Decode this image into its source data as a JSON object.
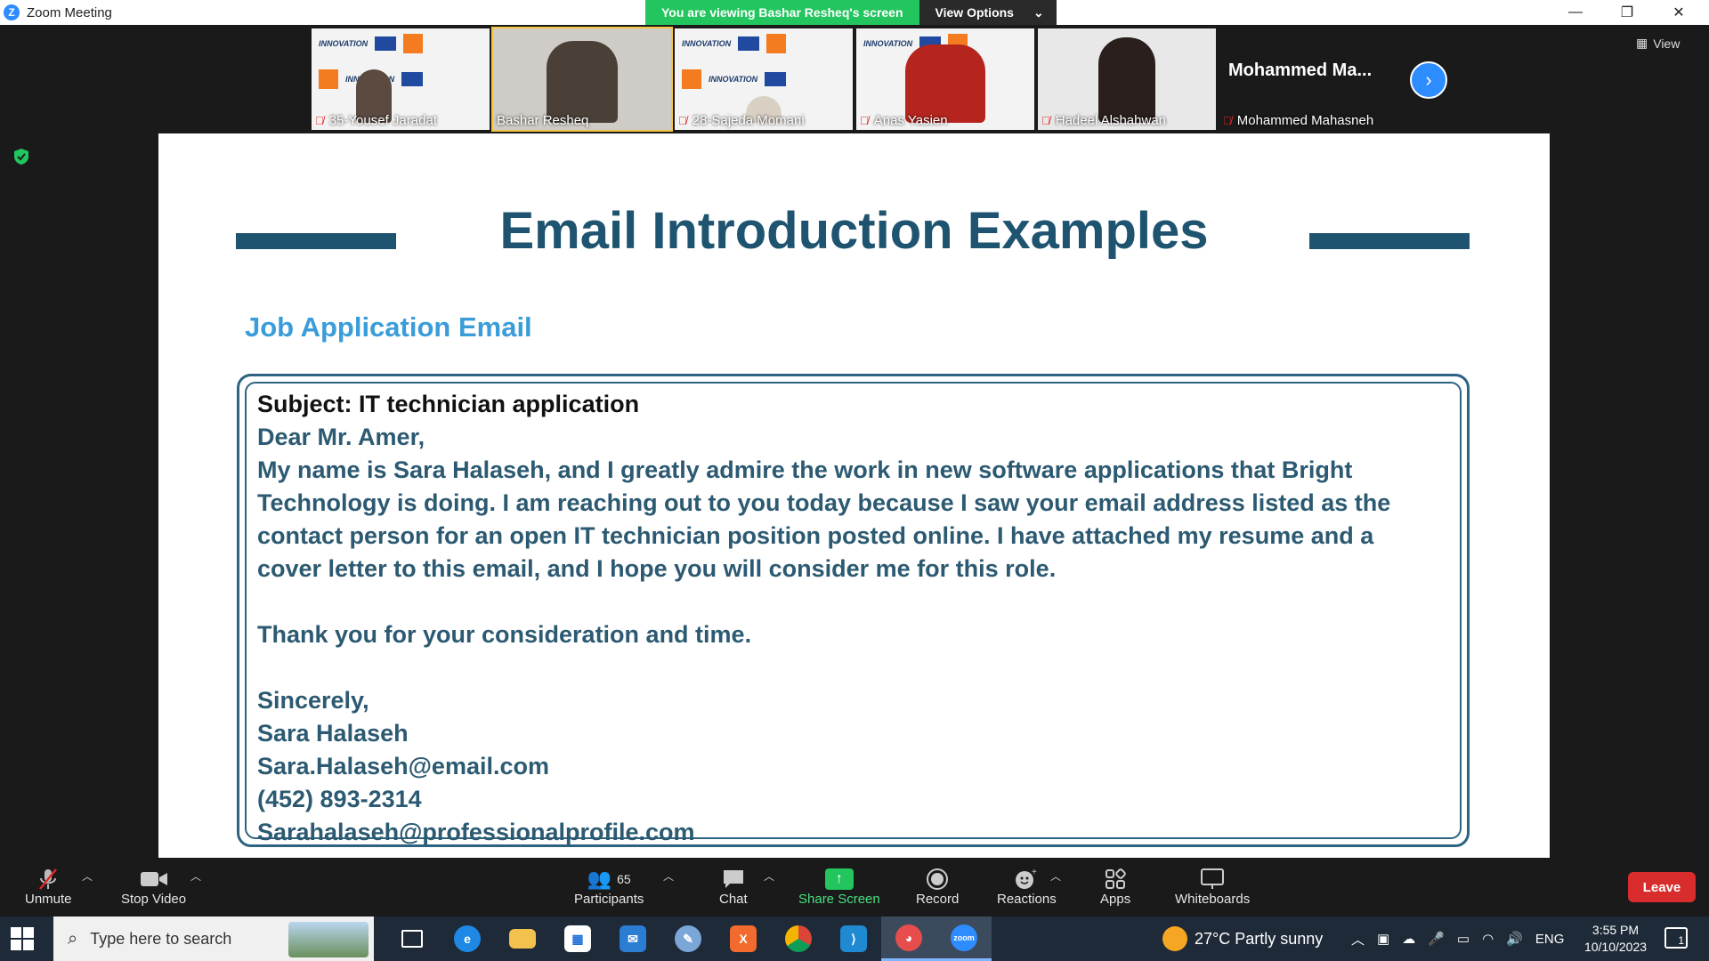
{
  "window": {
    "title": "Zoom Meeting",
    "viewing_banner": "You are viewing Bashar Resheq's screen",
    "view_options": "View Options",
    "view_button": "View"
  },
  "participants_strip": [
    {
      "name": "35-Yousef Jaradat",
      "muted": true
    },
    {
      "name": "Bashar Resheq",
      "muted": false
    },
    {
      "name": "28-Sajeda Momani",
      "muted": true
    },
    {
      "name": "Anas Yasien",
      "muted": true
    },
    {
      "name": "Hadeel Alshahwan",
      "muted": true
    },
    {
      "name": "Mohammed Mahasneh",
      "display_name": "Mohammed  Ma...",
      "muted": true
    }
  ],
  "slide": {
    "title": "Email Introduction Examples",
    "subtitle": "Job Application Email",
    "email": {
      "subject": "Subject: IT technician application",
      "greeting": "Dear Mr. Amer,",
      "body": "My name is Sara Halaseh, and I greatly admire the work in new software applications that Bright Technology is doing. I am reaching out to you today because I saw your email address listed as the contact person for an open IT technician position posted online. I have attached my resume and a cover letter to this email, and I hope you will consider me for this role.",
      "thanks": "Thank you for your consideration and time.",
      "closing": "Sincerely,",
      "signature_name": "Sara Halaseh",
      "signature_email": "Sara.Halaseh@email.com",
      "signature_phone": "(452) 893-2314",
      "signature_profile": "Sarahalaseh@professionalprofile.com"
    }
  },
  "toolbar": {
    "unmute": "Unmute",
    "stop_video": "Stop Video",
    "participants": "Participants",
    "participants_count": "65",
    "chat": "Chat",
    "share_screen": "Share Screen",
    "record": "Record",
    "reactions": "Reactions",
    "apps": "Apps",
    "whiteboards": "Whiteboards",
    "leave": "Leave"
  },
  "taskbar": {
    "search_placeholder": "Type here to search",
    "weather": "27°C  Partly sunny",
    "language": "ENG",
    "time": "3:55 PM",
    "date": "10/10/2023",
    "notifications": "1"
  },
  "colors": {
    "zoom_blue": "#2d8cff",
    "banner_green": "#22c55e",
    "leave_red": "#d92c2c",
    "slide_heading": "#1f5470",
    "slide_subheading": "#3a9dd9"
  }
}
